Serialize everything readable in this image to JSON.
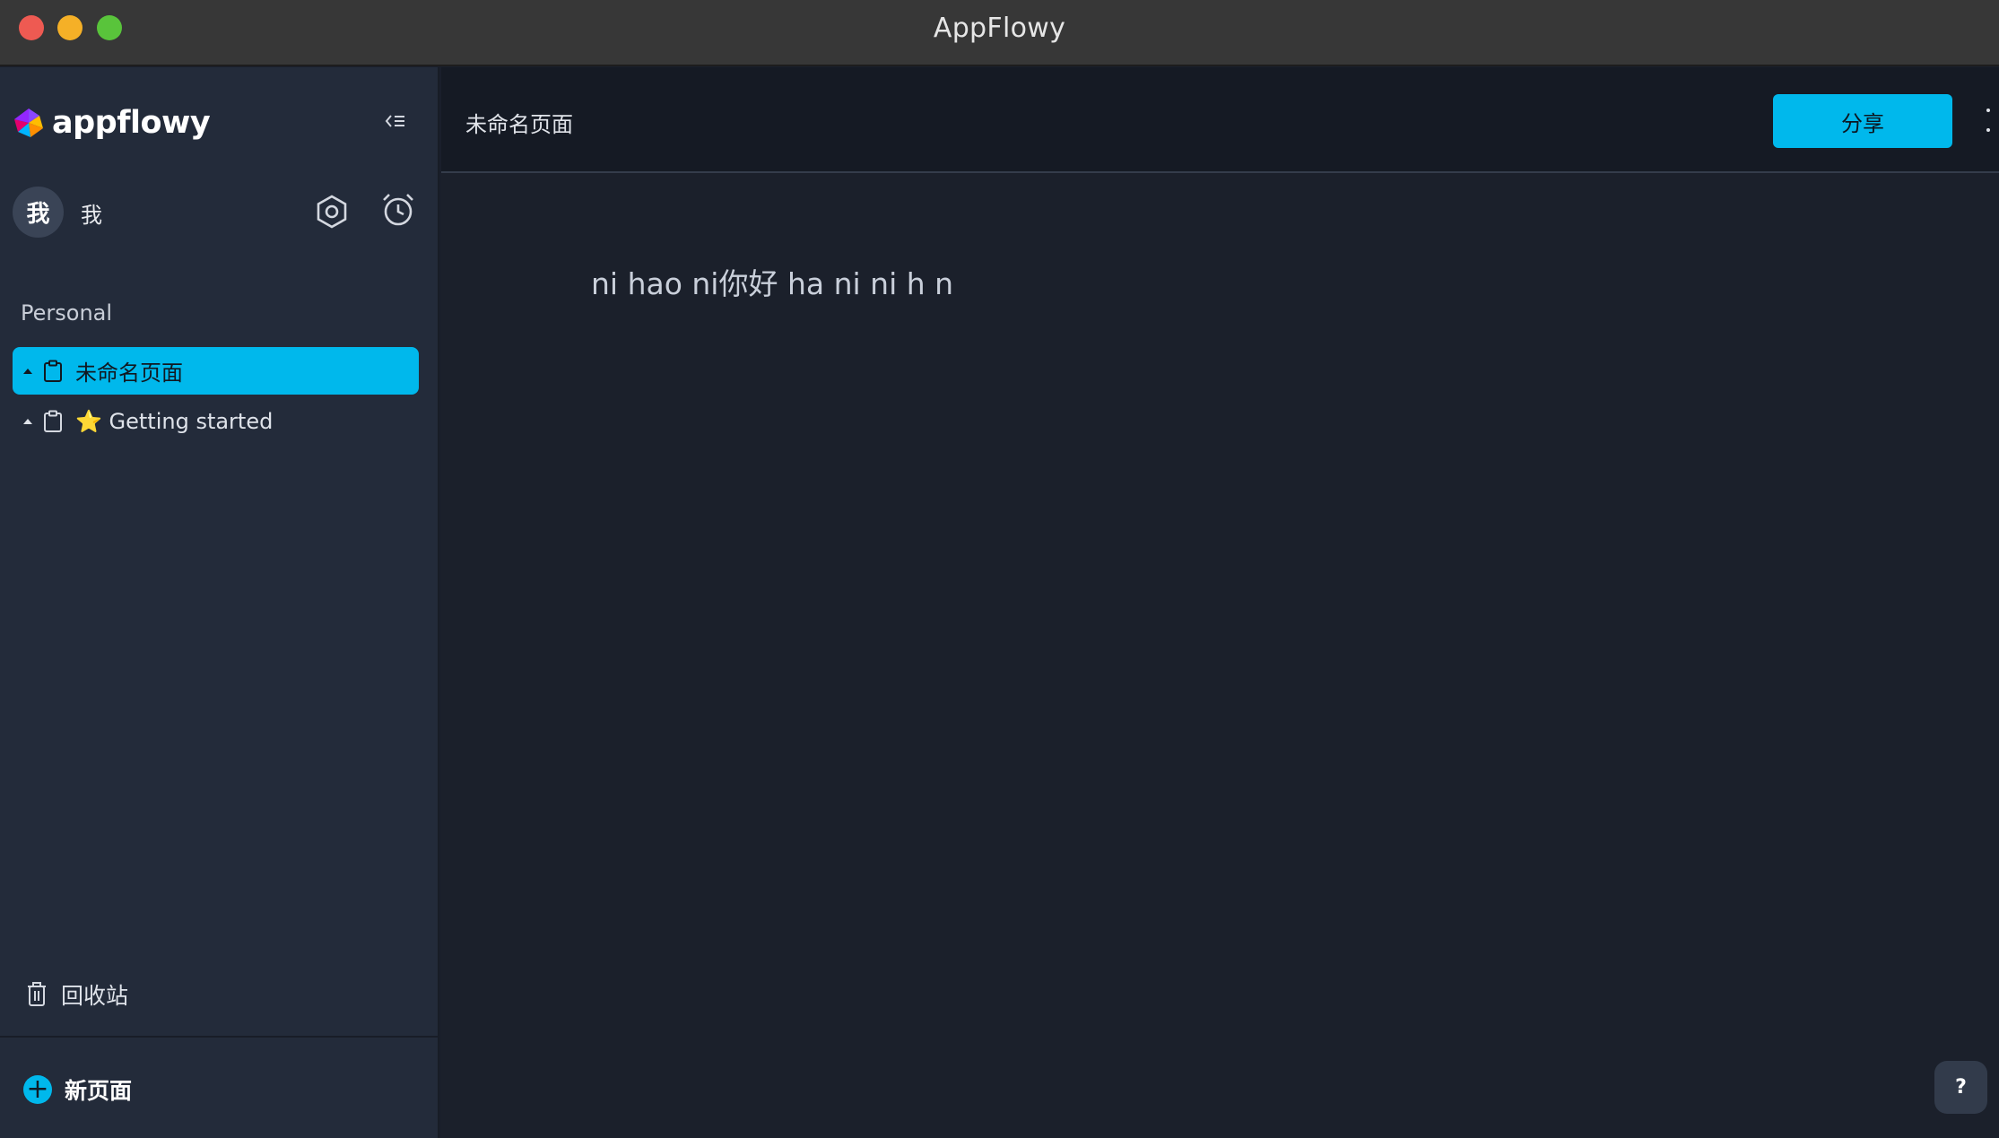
{
  "window": {
    "title": "AppFlowy"
  },
  "sidebar": {
    "logo_text": "appflowy",
    "user": {
      "avatar_initial": "我",
      "name": "我"
    },
    "section_label": "Personal",
    "pages": [
      {
        "label": "未命名页面",
        "selected": true
      },
      {
        "label": "⭐ Getting started",
        "selected": false
      }
    ],
    "trash_label": "回收站",
    "new_page_label": "新页面"
  },
  "main": {
    "page_title": "未命名页面",
    "share_label": "分享",
    "document_text": "ni hao ni你好 ha ni ni h n",
    "help_label": "?"
  },
  "colors": {
    "accent": "#00b8ec",
    "sidebar_bg": "#232b3a",
    "main_bg": "#1b202b",
    "header_bg": "#151a24"
  }
}
